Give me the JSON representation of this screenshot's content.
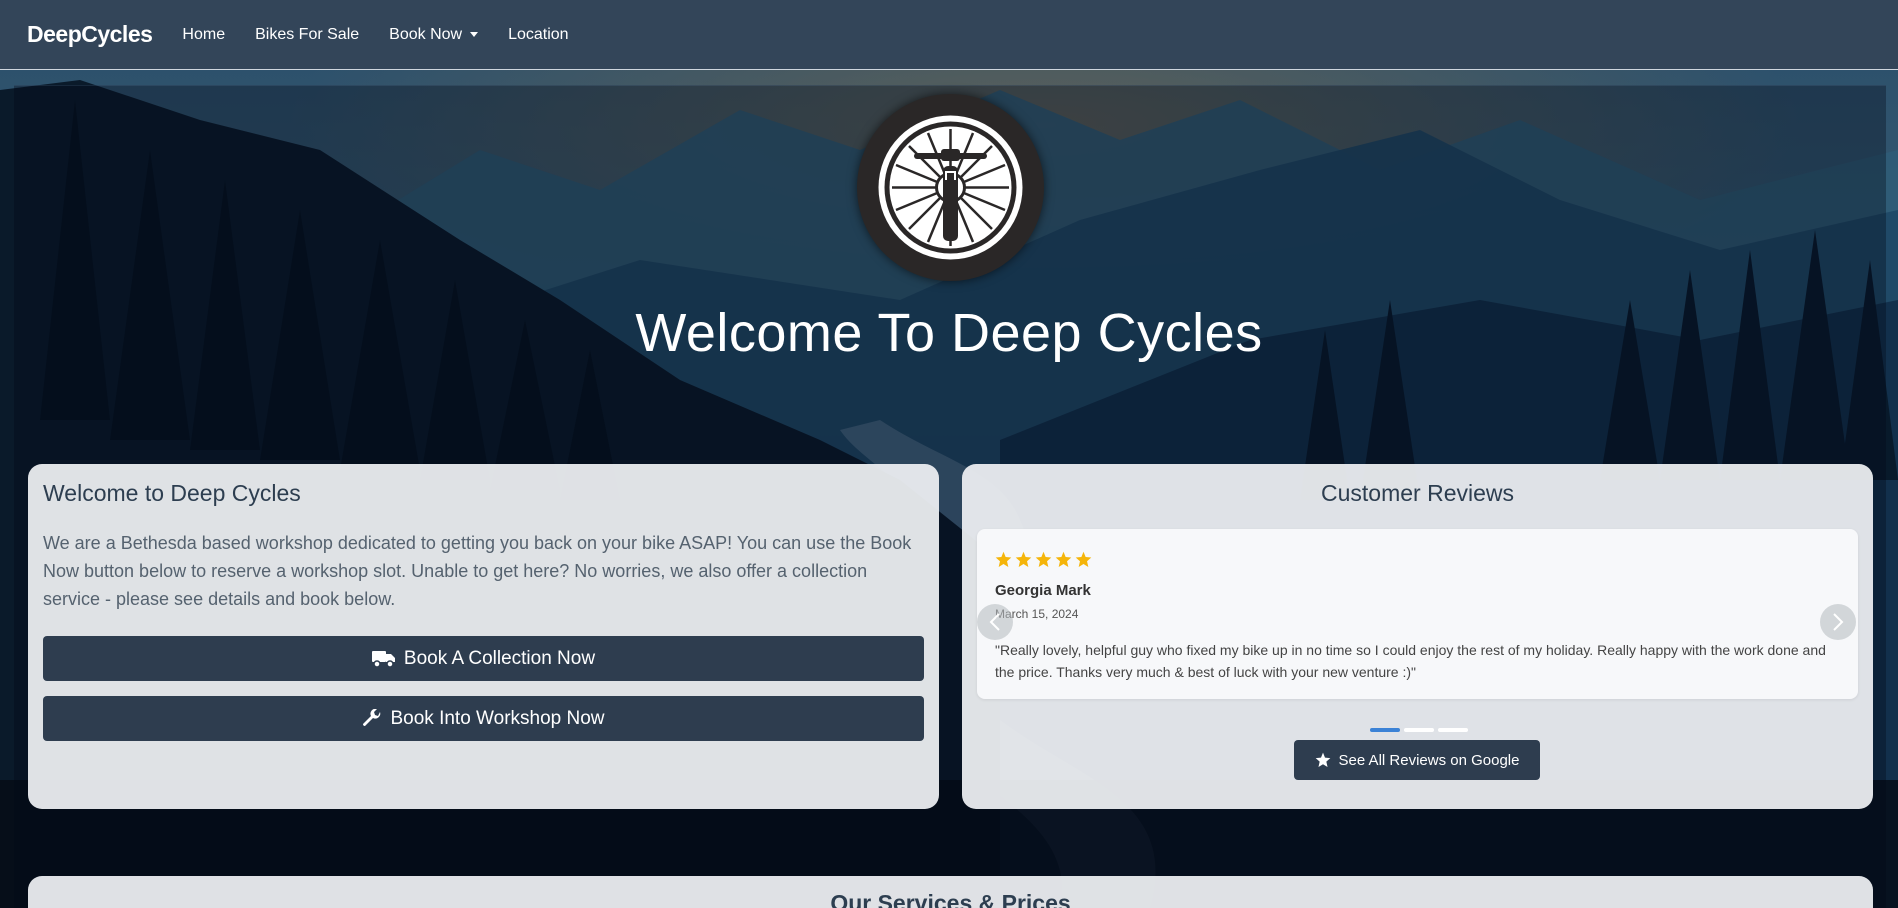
{
  "navbar": {
    "brand": "DeepCycles",
    "links": [
      {
        "label": "Home"
      },
      {
        "label": "Bikes For Sale"
      },
      {
        "label": "Book Now"
      },
      {
        "label": "Location"
      }
    ]
  },
  "hero": {
    "title": "Welcome To Deep Cycles"
  },
  "welcome_card": {
    "title": "Welcome to Deep Cycles",
    "text": "We are a Bethesda based workshop dedicated to getting you back on your bike ASAP! You can use the Book Now button below to reserve a workshop slot. Unable to get here? No worries, we also offer a collection service - please see details and book below.",
    "collection_button": "Book A Collection Now",
    "workshop_button": "Book Into Workshop Now",
    "collection_icon": "truck-icon",
    "workshop_icon": "wrench-icon"
  },
  "reviews_card": {
    "title": "Customer Reviews",
    "rating": 5,
    "review": {
      "author": "Georgia Mark",
      "date": "March 15, 2024",
      "text": "\"Really lovely, helpful guy who fixed my bike up in no time so I could enjoy the rest of my holiday. Really happy with the work done and the price. Thanks very much & best of luck with your new venture :)\""
    },
    "slide_count": 3,
    "active_slide": 1,
    "google_button": "See All Reviews on Google",
    "google_icon": "star-icon"
  },
  "services": {
    "title": "Our Services & Prices"
  },
  "colors": {
    "navbar_bg": "#334559",
    "button_bg": "#2e3d4f",
    "star": "#f5b50a",
    "dot_active": "#3b82d6",
    "card_bg": "#ebedf0"
  }
}
